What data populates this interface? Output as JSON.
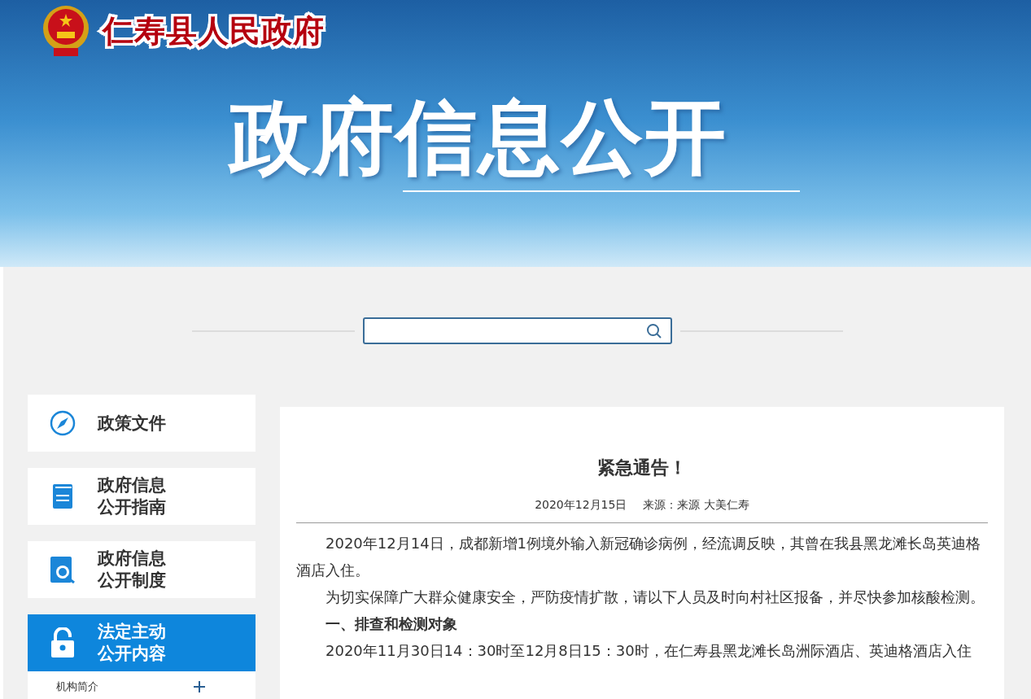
{
  "header": {
    "site_title": "仁寿县人民政府",
    "banner_title": "政府信息公开"
  },
  "sidebar": {
    "items": [
      {
        "label": "政策文件",
        "kind": "compass",
        "selected": false
      },
      {
        "label": "政府信息公开指南",
        "kind": "book",
        "selected": false
      },
      {
        "label": "政府信息公开制度",
        "kind": "search-doc",
        "selected": false
      },
      {
        "label": "法定主动公开内容",
        "kind": "lock",
        "selected": true,
        "children": [
          {
            "label": "机构简介",
            "expanded": false
          }
        ]
      }
    ]
  },
  "article": {
    "title": "紧急通告！",
    "date": "2020年12月15日",
    "source": "来源：来源 大美仁寿",
    "paragraphs": [
      {
        "kind": "text",
        "text": "2020年12月14日，成都新增1例境外输入新冠确诊病例，经流调反映，其曾在我县黑龙滩长岛英迪格酒店入住。"
      },
      {
        "kind": "text",
        "text": "为切实保障广大群众健康安全，严防疫情扩散，请以下人员及时向村社区报备，并尽快参加核酸检测。"
      },
      {
        "kind": "heading",
        "text": "一、排查和检测对象"
      },
      {
        "kind": "text",
        "text": "2020年11月30日14：30时至12月8日15：30时，在仁寿县黑龙滩长岛洲际酒店、英迪格酒店入住"
      }
    ]
  }
}
